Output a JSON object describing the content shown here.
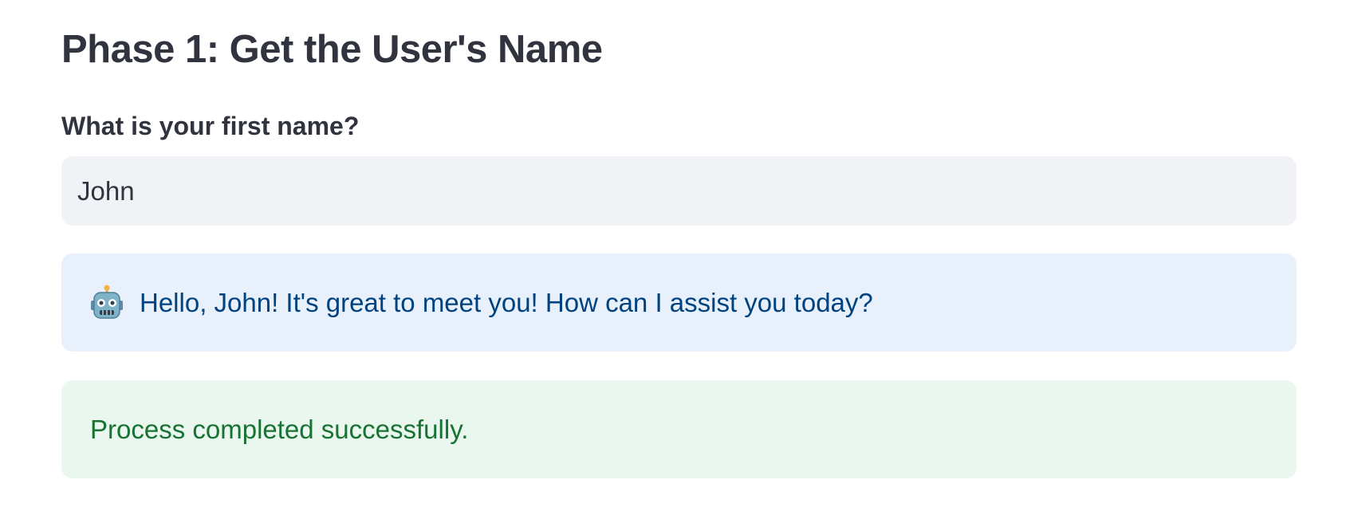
{
  "page": {
    "title": "Phase 1: Get the User's Name"
  },
  "name_field": {
    "label": "What is your first name?",
    "value": "John"
  },
  "info_alert": {
    "icon": "robot-icon",
    "message": "Hello, John! It's great to meet you! How can I assist you today?"
  },
  "success_alert": {
    "message": "Process completed successfully."
  },
  "colors": {
    "text": "#31333f",
    "input_bg": "#f0f2f6",
    "info_bg": "#e8f0fc",
    "info_text": "#004280",
    "success_bg": "#e9f7ee",
    "success_text": "#177233"
  }
}
